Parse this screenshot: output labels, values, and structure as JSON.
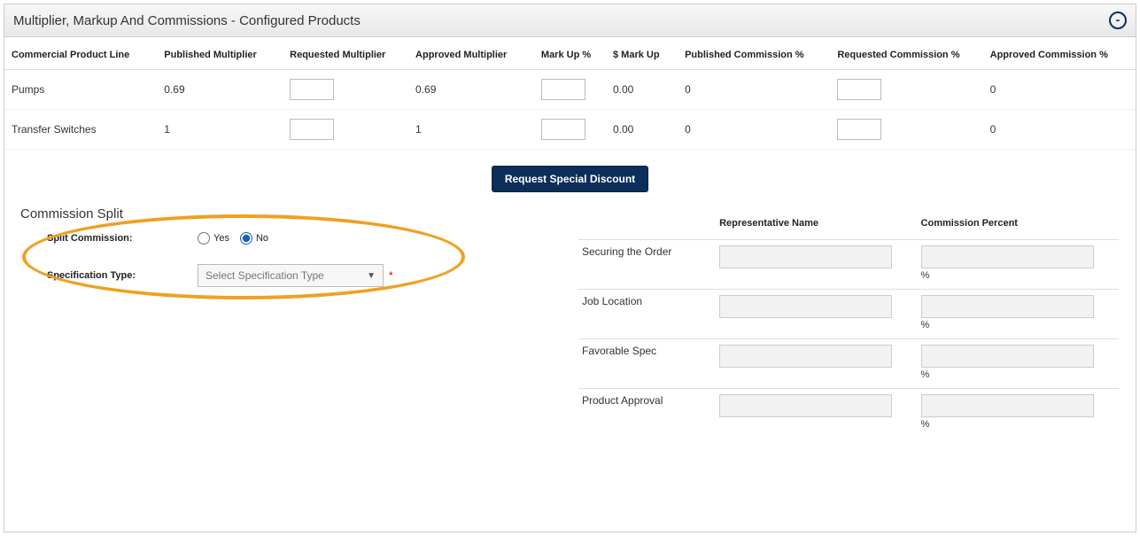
{
  "panel": {
    "title": "Multiplier, Markup And Commissions - Configured Products",
    "collapse": "-"
  },
  "grid": {
    "headers": {
      "c0": "Commercial Product Line",
      "c1": "Published Multiplier",
      "c2": "Requested Multiplier",
      "c3": "Approved Multiplier",
      "c4": "Mark Up %",
      "c5": "$ Mark Up",
      "c6": "Published Commission %",
      "c7": "Requested Commission %",
      "c8": "Approved Commission %"
    },
    "rows": [
      {
        "line": "Pumps",
        "pubMul": "0.69",
        "reqMul": "",
        "apprMul": "0.69",
        "markPct": "",
        "dolMark": "0.00",
        "pubComm": "0",
        "reqComm": "",
        "apprComm": "0"
      },
      {
        "line": "Transfer Switches",
        "pubMul": "1",
        "reqMul": "",
        "apprMul": "1",
        "markPct": "",
        "dolMark": "0.00",
        "pubComm": "0",
        "reqComm": "",
        "apprComm": "0"
      }
    ]
  },
  "actions": {
    "requestDiscount": "Request Special Discount"
  },
  "commissionSplit": {
    "title": "Commission Split",
    "labels": {
      "splitCommission": "Split Commission:",
      "specType": "Specification Type:",
      "yes": "Yes",
      "no": "No",
      "selectPlaceholder": "Select Specification Type"
    },
    "splitValue": "No",
    "table": {
      "headers": {
        "repName": "Representative Name",
        "commPct": "Commission Percent"
      },
      "rows": [
        {
          "label": "Securing the Order",
          "name": "",
          "pct": ""
        },
        {
          "label": "Job Location",
          "name": "",
          "pct": ""
        },
        {
          "label": "Favorable Spec",
          "name": "",
          "pct": ""
        },
        {
          "label": "Product Approval",
          "name": "",
          "pct": ""
        }
      ],
      "pctSuffix": "%"
    }
  }
}
